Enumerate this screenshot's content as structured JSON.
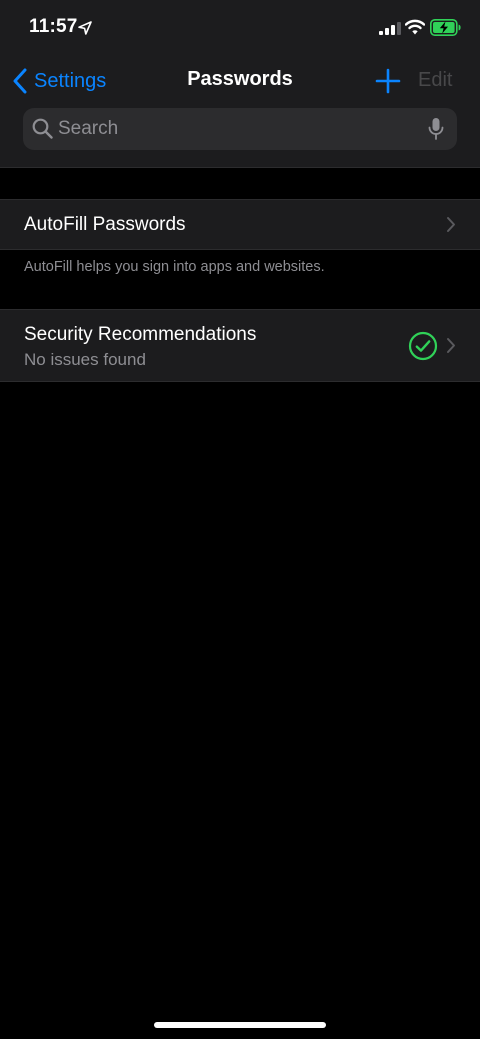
{
  "status_bar": {
    "time": "11:57"
  },
  "nav": {
    "back_label": "Settings",
    "title": "Passwords",
    "edit_label": "Edit"
  },
  "search": {
    "placeholder": "Search",
    "value": ""
  },
  "autofill": {
    "title": "AutoFill Passwords",
    "footer": "AutoFill helps you sign into apps and websites."
  },
  "security": {
    "title": "Security Recommendations",
    "subtitle": "No issues found"
  },
  "colors": {
    "accent": "#0a84ff",
    "success": "#30d158",
    "battery": "#30d158",
    "disabled_text": "#48484a",
    "secondary_text": "#8e8e93",
    "cell_background": "#1c1c1e",
    "background": "#000000"
  },
  "icons": {
    "location": "location-arrow-icon",
    "signal": "cellular-signal-icon",
    "wifi": "wifi-icon",
    "battery": "battery-charging-icon",
    "back": "chevron-left-icon",
    "add": "plus-icon",
    "search": "magnifying-glass-icon",
    "mic": "microphone-icon",
    "check": "checkmark-circle-icon",
    "disclosure": "chevron-right-icon"
  }
}
